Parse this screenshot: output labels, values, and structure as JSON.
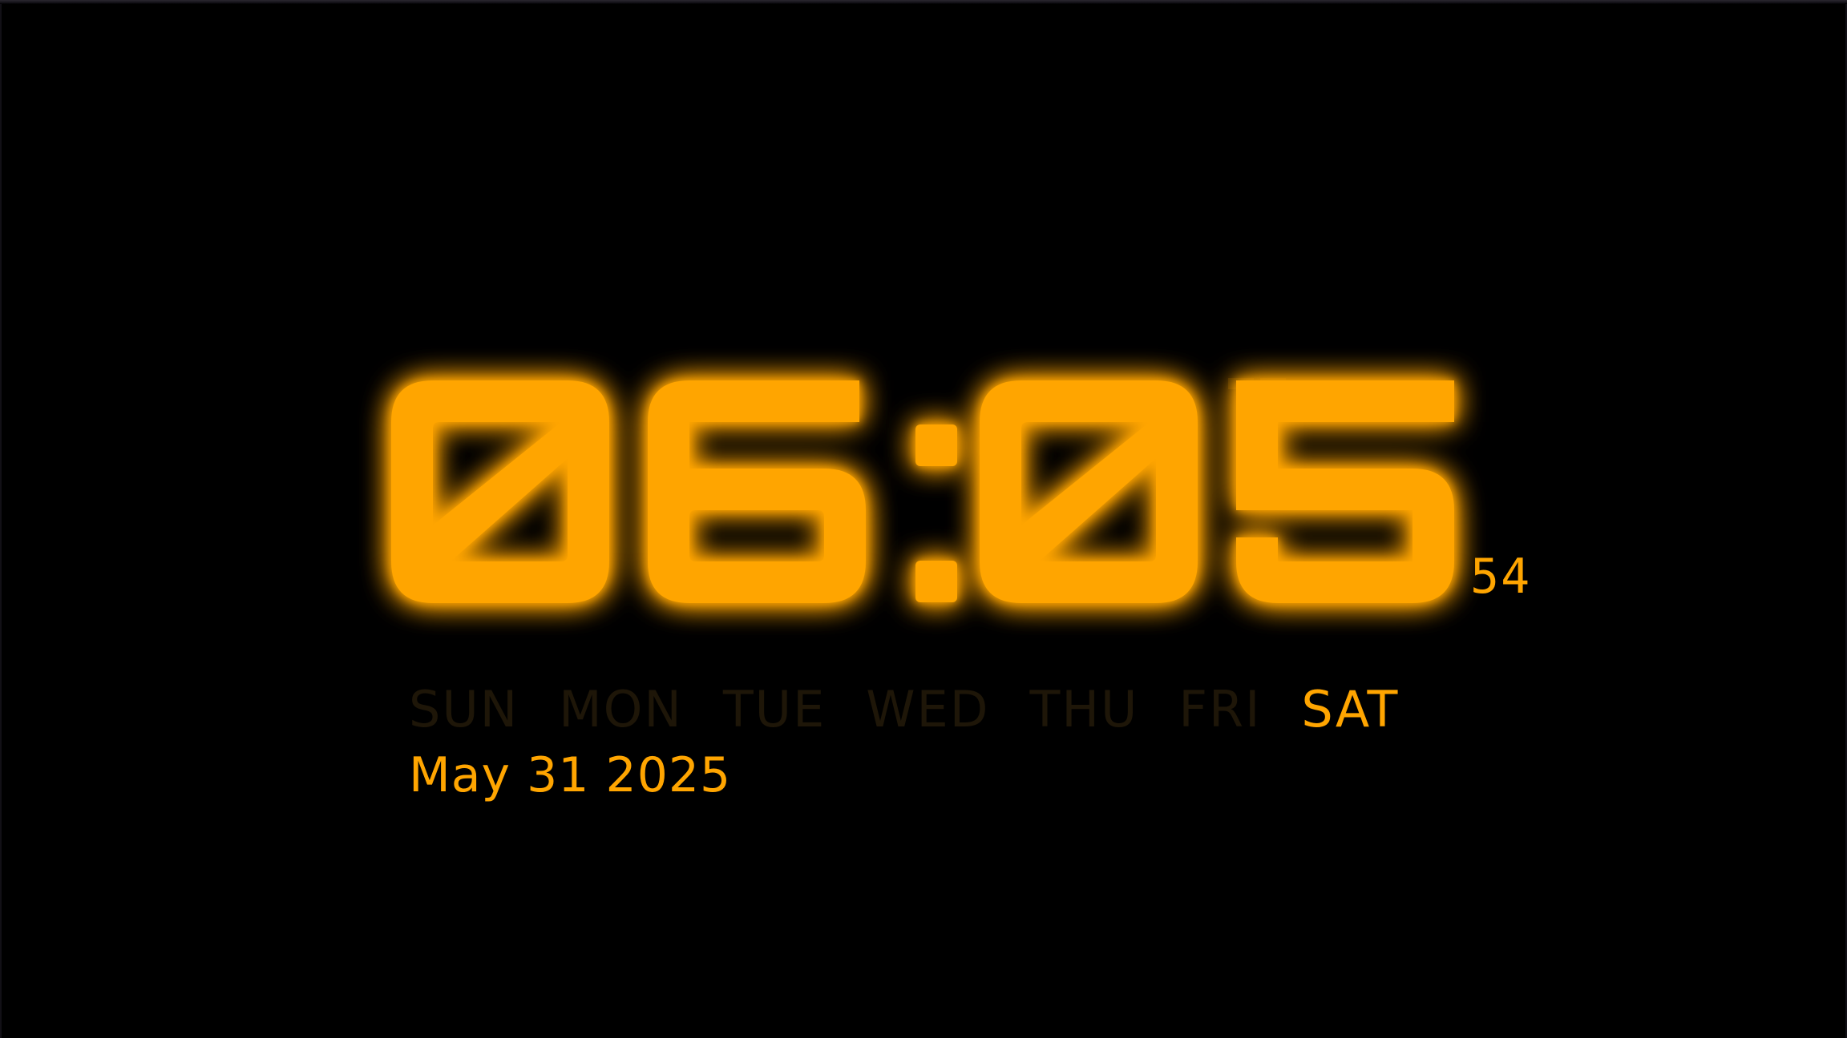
{
  "clock": {
    "hours": "06",
    "separator": ":",
    "minutes": "05",
    "seconds": "54",
    "digit_color": "#ffa500",
    "glow_color": "#ff9a00"
  },
  "weekdays": {
    "items": [
      {
        "label": "SUN",
        "active": false
      },
      {
        "label": "MON",
        "active": false
      },
      {
        "label": "TUE",
        "active": false
      },
      {
        "label": "WED",
        "active": false
      },
      {
        "label": "THU",
        "active": false
      },
      {
        "label": "FRI",
        "active": false
      },
      {
        "label": "SAT",
        "active": true
      }
    ],
    "active_color": "#ffa500",
    "inactive_color": "#1e1608"
  },
  "date": {
    "text": "May 31 2025"
  }
}
